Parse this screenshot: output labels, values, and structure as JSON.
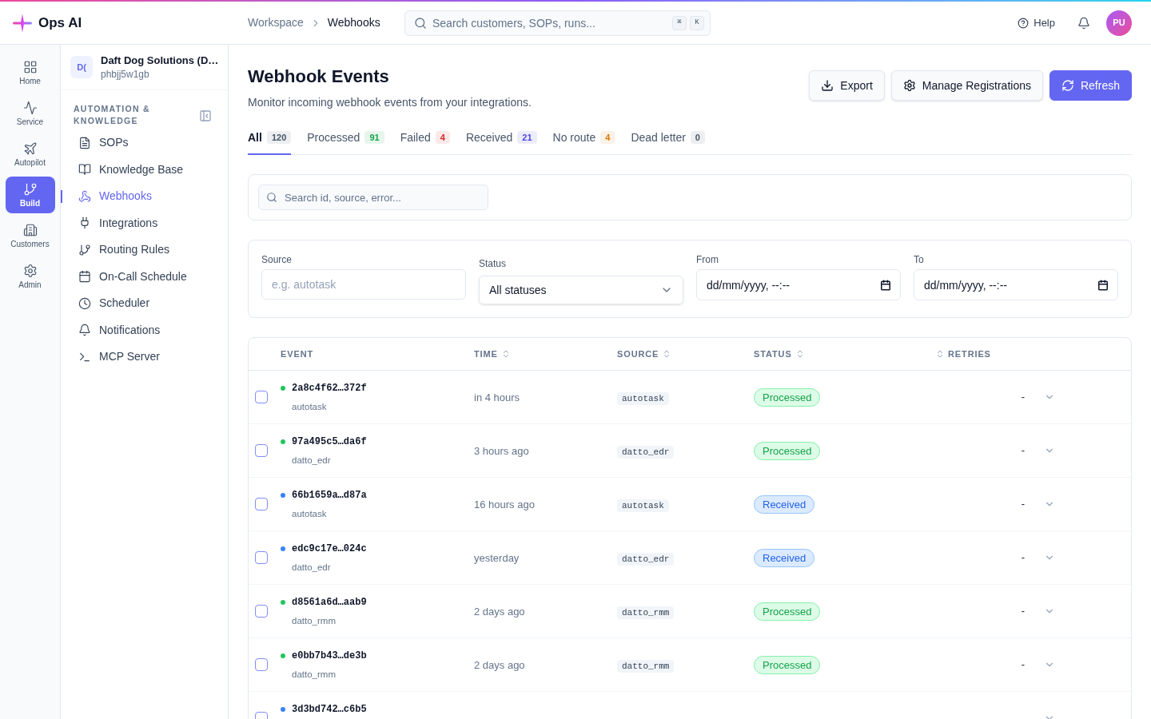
{
  "app": {
    "name": "Ops AI"
  },
  "breadcrumb": [
    "Workspace",
    "Webhooks"
  ],
  "global_search": {
    "placeholder": "Search customers, SOPs, runs...",
    "shortcut": [
      "⌘",
      "K"
    ]
  },
  "toolbar": {
    "help": "Help",
    "avatar": "PU"
  },
  "rail": [
    {
      "label": "Home",
      "selected": false
    },
    {
      "label": "Service",
      "selected": false
    },
    {
      "label": "Autopilot",
      "selected": false
    },
    {
      "label": "Build",
      "selected": true
    },
    {
      "label": "Customers",
      "selected": false
    },
    {
      "label": "Admin",
      "selected": false
    }
  ],
  "workspace": {
    "badge": "D(",
    "name": "Daft Dog Solutions (D…",
    "id": "phbjj5w1gb"
  },
  "nav": {
    "section": "AUTOMATION & KNOWLEDGE",
    "items": [
      {
        "label": "SOPs",
        "selected": false
      },
      {
        "label": "Knowledge Base",
        "selected": false
      },
      {
        "label": "Webhooks",
        "selected": true
      },
      {
        "label": "Integrations",
        "selected": false
      },
      {
        "label": "Routing Rules",
        "selected": false
      },
      {
        "label": "On-Call Schedule",
        "selected": false
      },
      {
        "label": "Scheduler",
        "selected": false
      },
      {
        "label": "Notifications",
        "selected": false
      },
      {
        "label": "MCP Server",
        "selected": false
      }
    ]
  },
  "page": {
    "title": "Webhook Events",
    "subtitle": "Monitor incoming webhook events from your integrations.",
    "actions": [
      {
        "label": "Export",
        "kind": "secondary"
      },
      {
        "label": "Manage Registrations",
        "kind": "secondary"
      },
      {
        "label": "Refresh",
        "kind": "primary"
      }
    ]
  },
  "tabs": [
    {
      "label": "All",
      "count": "120",
      "selected": true,
      "color": "#475569"
    },
    {
      "label": "Processed",
      "count": "91",
      "selected": false,
      "color": "#16a34a"
    },
    {
      "label": "Failed",
      "count": "4",
      "selected": false,
      "color": "#dc2626"
    },
    {
      "label": "Received",
      "count": "21",
      "selected": false,
      "color": "#4f46e5"
    },
    {
      "label": "No route",
      "count": "4",
      "selected": false,
      "color": "#d97706"
    },
    {
      "label": "Dead letter",
      "count": "0",
      "selected": false,
      "color": "#475569"
    }
  ],
  "quick_search": {
    "placeholder": "Search id, source, error..."
  },
  "filters": [
    {
      "label": "Source",
      "kind": "text",
      "placeholder": "e.g. autotask"
    },
    {
      "label": "Status",
      "kind": "select",
      "value": "All statuses"
    },
    {
      "label": "From",
      "kind": "datetime",
      "placeholder": "dd/mm/yyyy, --:--"
    },
    {
      "label": "To",
      "kind": "datetime",
      "placeholder": "dd/mm/yyyy, --:--"
    }
  ],
  "table": {
    "columns": [
      {
        "label": "EVENT",
        "sortable": false
      },
      {
        "label": "TIME",
        "sortable": true
      },
      {
        "label": "SOURCE",
        "sortable": true
      },
      {
        "label": "STATUS",
        "sortable": true
      },
      {
        "label": "RETRIES",
        "sortable": true
      }
    ],
    "rows": [
      {
        "id": "2a8c4f62…372f",
        "origin": "autotask",
        "time": "in 4 hours",
        "source": "autotask",
        "status": "Processed",
        "kind": "processed",
        "retries": "-",
        "checked": false
      },
      {
        "id": "97a495c5…da6f",
        "origin": "datto_edr",
        "time": "3 hours ago",
        "source": "datto_edr",
        "status": "Processed",
        "kind": "processed",
        "retries": "-",
        "checked": false
      },
      {
        "id": "66b1659a…d87a",
        "origin": "autotask",
        "time": "16 hours ago",
        "source": "autotask",
        "status": "Received",
        "kind": "received",
        "retries": "-",
        "checked": false
      },
      {
        "id": "edc9c17e…024c",
        "origin": "datto_edr",
        "time": "yesterday",
        "source": "datto_edr",
        "status": "Received",
        "kind": "received",
        "retries": "-",
        "checked": false
      },
      {
        "id": "d8561a6d…aab9",
        "origin": "datto_rmm",
        "time": "2 days ago",
        "source": "datto_rmm",
        "status": "Processed",
        "kind": "processed",
        "retries": "-",
        "checked": false
      },
      {
        "id": "e0bb7b43…de3b",
        "origin": "datto_rmm",
        "time": "2 days ago",
        "source": "datto_rmm",
        "status": "Processed",
        "kind": "processed",
        "retries": "-",
        "checked": false
      },
      {
        "id": "3d3bd742…c6b5",
        "kind": "received",
        "checked": false
      }
    ]
  }
}
